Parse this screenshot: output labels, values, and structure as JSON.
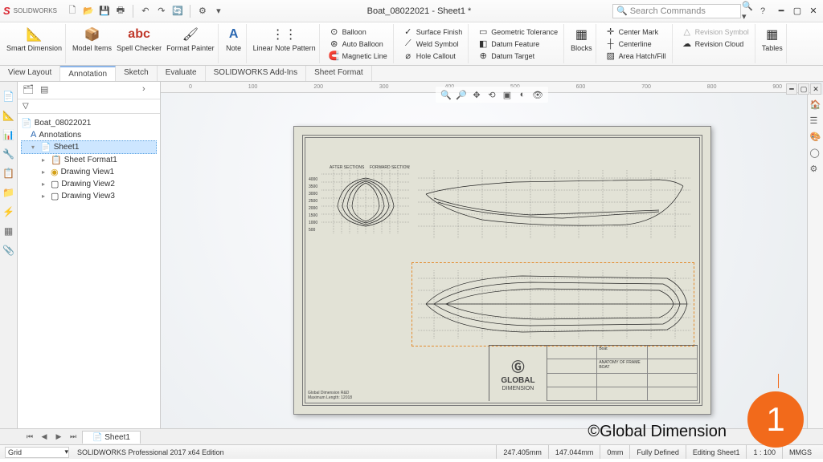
{
  "app": {
    "logo": "S",
    "logoText": "SOLIDWORKS",
    "title": "Boat_08022021 - Sheet1 *",
    "searchPlaceholder": "Search Commands",
    "edition": "SOLIDWORKS Professional 2017 x64 Edition"
  },
  "ribbon": {
    "smartDimension": "Smart Dimension",
    "modelItems": "Model Items",
    "spellChecker": "Spell Checker",
    "formatPainter": "Format Painter",
    "note": "Note",
    "linearNotePattern": "Linear Note Pattern",
    "balloon": "Balloon",
    "autoBalloon": "Auto Balloon",
    "magneticLine": "Magnetic Line",
    "surfaceFinish": "Surface Finish",
    "weldSymbol": "Weld Symbol",
    "holeCallout": "Hole Callout",
    "geoTol": "Geometric Tolerance",
    "datumFeature": "Datum Feature",
    "datumTarget": "Datum Target",
    "blocks": "Blocks",
    "centerMark": "Center Mark",
    "centerline": "Centerline",
    "areaHatch": "Area Hatch/Fill",
    "revSymbol": "Revision Symbol",
    "revCloud": "Revision Cloud",
    "tables": "Tables"
  },
  "tabs": [
    "View Layout",
    "Annotation",
    "Sketch",
    "Evaluate",
    "SOLIDWORKS Add-Ins",
    "Sheet Format"
  ],
  "activeTab": "Annotation",
  "tree": {
    "root": "Boat_08022021",
    "annotations": "Annotations",
    "sheet": "Sheet1",
    "sheetFormat": "Sheet Format1",
    "view1": "Drawing View1",
    "view2": "Drawing View2",
    "view3": "Drawing View3"
  },
  "rulerMarks": [
    "0",
    "100",
    "200",
    "300",
    "400",
    "500",
    "600",
    "700",
    "800",
    "900"
  ],
  "drawing": {
    "sectionLabels": {
      "aft": "AFTER SECTIONS",
      "fwd": "FORWARD SECTIONS"
    },
    "yTicks": [
      "4000",
      "3500",
      "3000",
      "2500",
      "2000",
      "1500",
      "1000",
      "500"
    ],
    "titleBlock": {
      "company": "GLOBAL",
      "company2": "DIMENSION",
      "title": "Boat",
      "subtitle": "ANATOMY OF FRAME BOAT",
      "descLines": [
        "Global Dimension R&D",
        "Maximum Length: 12018"
      ]
    }
  },
  "sheetTabs": [
    "Sheet1"
  ],
  "status": {
    "dropdown": "Grid",
    "coordX": "247.405mm",
    "coordY": "147.044mm",
    "coordZ": "0mm",
    "defined": "Fully Defined",
    "editing": "Editing Sheet1",
    "scale": "1 : 100",
    "units": "MMGS"
  },
  "watermark": "©Global Dimension",
  "badgeNum": "1"
}
